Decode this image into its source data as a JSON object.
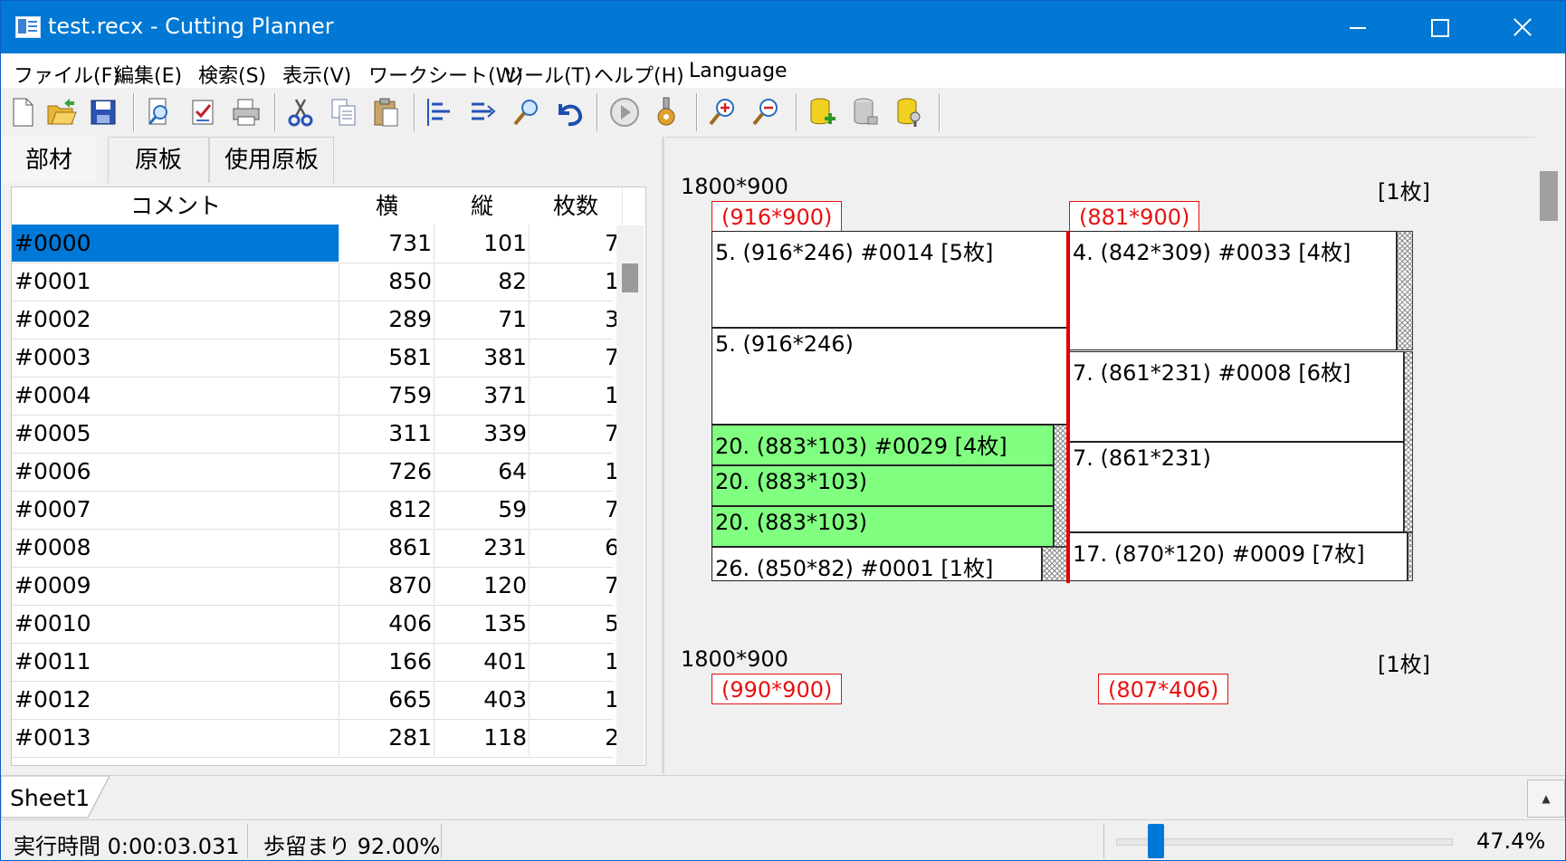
{
  "window": {
    "title": "test.recx - Cutting Planner"
  },
  "menu": [
    "ファイル(F)",
    "編集(E)",
    "検索(S)",
    "表示(V)",
    "ワークシート(W)",
    "ツール(T)",
    "ヘルプ(H)",
    "Language"
  ],
  "toolbar_icons": [
    "new-file-icon",
    "open-folder-icon",
    "save-icon",
    "preview-icon",
    "check-sheet-icon",
    "print-icon",
    "cut-icon",
    "copy-icon",
    "paste-icon",
    "align-left-icon",
    "align-right-icon",
    "find-icon",
    "undo-icon",
    "run-icon",
    "settings-gear-icon",
    "zoom-in-icon",
    "zoom-out-icon",
    "db-add-icon",
    "db-icon",
    "db-key-icon"
  ],
  "tabs": [
    "部材",
    "原板",
    "使用原板"
  ],
  "grid": {
    "headers": [
      "コメント",
      "横",
      "縦",
      "枚数"
    ],
    "rows": [
      {
        "comment": "#0000",
        "w": "731",
        "h": "101",
        "n": "7"
      },
      {
        "comment": "#0001",
        "w": "850",
        "h": "82",
        "n": "1"
      },
      {
        "comment": "#0002",
        "w": "289",
        "h": "71",
        "n": "3"
      },
      {
        "comment": "#0003",
        "w": "581",
        "h": "381",
        "n": "7"
      },
      {
        "comment": "#0004",
        "w": "759",
        "h": "371",
        "n": "1"
      },
      {
        "comment": "#0005",
        "w": "311",
        "h": "339",
        "n": "7"
      },
      {
        "comment": "#0006",
        "w": "726",
        "h": "64",
        "n": "1"
      },
      {
        "comment": "#0007",
        "w": "812",
        "h": "59",
        "n": "7"
      },
      {
        "comment": "#0008",
        "w": "861",
        "h": "231",
        "n": "6"
      },
      {
        "comment": "#0009",
        "w": "870",
        "h": "120",
        "n": "7"
      },
      {
        "comment": "#0010",
        "w": "406",
        "h": "135",
        "n": "5"
      },
      {
        "comment": "#0011",
        "w": "166",
        "h": "401",
        "n": "1"
      },
      {
        "comment": "#0012",
        "w": "665",
        "h": "403",
        "n": "1"
      },
      {
        "comment": "#0013",
        "w": "281",
        "h": "118",
        "n": "2"
      }
    ]
  },
  "layout": {
    "sheet1": {
      "size": "1800*900",
      "count": "[1枚]",
      "regions": [
        "(916*900)",
        "(881*900)"
      ],
      "pieces": [
        "5. (916*246) #0014 [5枚]",
        "5. (916*246)",
        "20. (883*103) #0029 [4枚]",
        "20. (883*103)",
        "20. (883*103)",
        "26. (850*82) #0001 [1枚]",
        "4. (842*309) #0033 [4枚]",
        "7. (861*231) #0008 [6枚]",
        "7. (861*231)",
        "17. (870*120) #0009 [7枚]"
      ]
    },
    "sheet2": {
      "size": "1800*900",
      "count": "[1枚]",
      "regions": [
        "(990*900)",
        "(807*406)"
      ]
    }
  },
  "sheet_tab": "Sheet1",
  "status": {
    "exec_time": "実行時間 0:00:03.031",
    "yield": "歩留まり 92.00%",
    "zoom": "47.4%",
    "zoom_slider_fraction": 0.12
  },
  "colors": {
    "titlebar": "#0078d4",
    "selection": "#0078d7",
    "highlight_piece": "#80ff80",
    "cut_line": "#e00000",
    "region_label": "#e81010"
  }
}
